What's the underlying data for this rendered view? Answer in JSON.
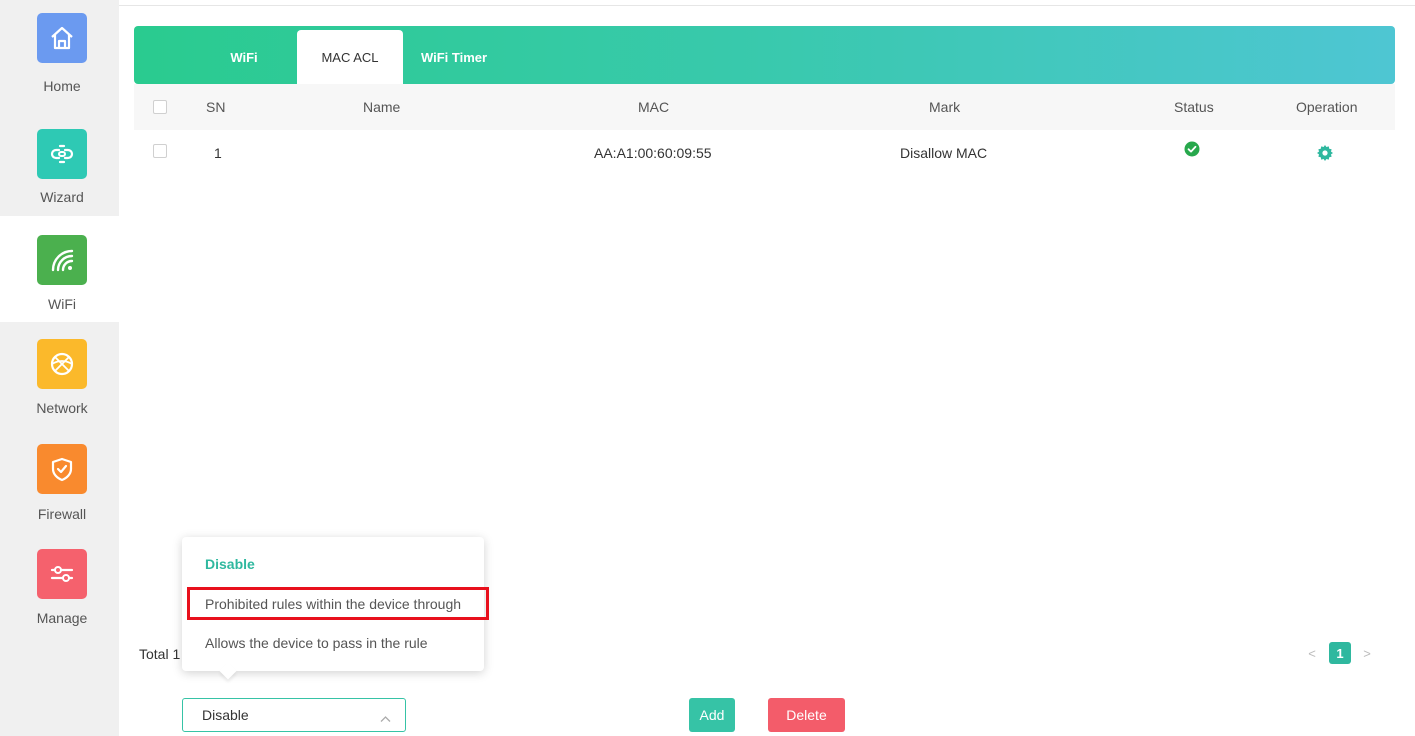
{
  "sidebar": {
    "items": [
      {
        "label": "Home",
        "icon": "home-icon",
        "color": "#6b9af0"
      },
      {
        "label": "Wizard",
        "icon": "link-icon",
        "color": "#2ec9b4"
      },
      {
        "label": "WiFi",
        "icon": "wifi-icon",
        "color": "#4bb04e"
      },
      {
        "label": "Network",
        "icon": "globe-icon",
        "color": "#fbb92b"
      },
      {
        "label": "Firewall",
        "icon": "shield-icon",
        "color": "#f98a2e"
      },
      {
        "label": "Manage",
        "icon": "sliders-icon",
        "color": "#f5616d"
      }
    ]
  },
  "tabs": [
    {
      "label": "WiFi"
    },
    {
      "label": "MAC ACL"
    },
    {
      "label": "WiFi Timer"
    }
  ],
  "table": {
    "columns": [
      "SN",
      "Name",
      "MAC",
      "Mark",
      "Status",
      "Operation"
    ],
    "rows": [
      {
        "sn": "1",
        "name": "",
        "mac": "AA:A1:00:60:09:55",
        "mark": "Disallow MAC",
        "status": "enabled"
      }
    ]
  },
  "footer": {
    "total_label": "Total 1",
    "current_page": "1",
    "prev_glyph": "<",
    "next_glyph": ">"
  },
  "mode_dropdown": {
    "options": [
      "Disable",
      "Prohibited rules within the device through",
      "Allows the device to pass in the rule"
    ],
    "selected": "Disable"
  },
  "buttons": {
    "add": "Add",
    "delete": "Delete"
  },
  "colors": {
    "accent": "#36c3a6",
    "delete": "#f35c6a",
    "status_ok": "#27a84c"
  }
}
